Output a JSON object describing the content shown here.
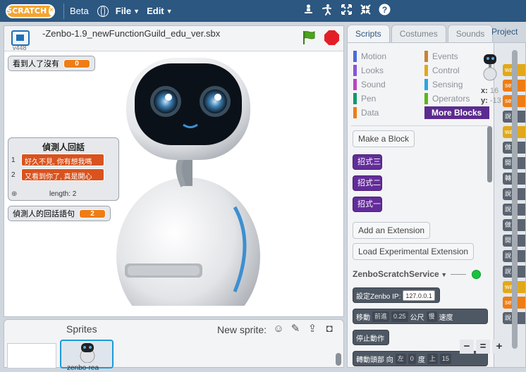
{
  "menubar": {
    "logo": "SCRATCH",
    "beta": "Beta",
    "menus": [
      "File",
      "Edit"
    ],
    "tool_icons": [
      "duplicate-icon",
      "cut-icon",
      "grow-icon",
      "shrink-icon",
      "help-icon"
    ]
  },
  "stage": {
    "version": "v448",
    "project_title": "-Zenbo-1.9_newFunctionGuild_edu_ver.sbx",
    "var1": {
      "label": "看到人了沒有",
      "value": "0"
    },
    "list": {
      "title": "偵測人回話",
      "items": [
        "好久不見, 你有想我嗎",
        "又看到你了, 真是開心"
      ],
      "length": "length: 2"
    },
    "var2": {
      "label": "偵測人的回話語句",
      "value": "2"
    },
    "coords": {
      "x_label": "x:",
      "x": "240",
      "y_label": "y:",
      "y": "-94"
    }
  },
  "sprites": {
    "title": "Sprites",
    "new_sprite": "New sprite:",
    "sprite_name": "zenbo-rea"
  },
  "tabs": {
    "scripts": "Scripts",
    "costumes": "Costumes",
    "sounds": "Sounds",
    "project": "Project"
  },
  "categories": {
    "left": [
      {
        "name": "Motion",
        "color": "#4a6cd4"
      },
      {
        "name": "Looks",
        "color": "#8a55d7"
      },
      {
        "name": "Sound",
        "color": "#bb42c3"
      },
      {
        "name": "Pen",
        "color": "#0e9a6c"
      },
      {
        "name": "Data",
        "color": "#ee7d16"
      }
    ],
    "right": [
      {
        "name": "Events",
        "color": "#c88330"
      },
      {
        "name": "Control",
        "color": "#e1a91a"
      },
      {
        "name": "Sensing",
        "color": "#2ca5e2"
      },
      {
        "name": "Operators",
        "color": "#5cb712"
      },
      {
        "name": "More Blocks",
        "color": "#632d99"
      }
    ]
  },
  "palette": {
    "make_block": "Make a Block",
    "custom_blocks": [
      "招式三",
      "招式二",
      "招式一"
    ],
    "add_extension": "Add an Extension",
    "load_experimental": "Load Experimental Extension",
    "extension_name": "ZenboScratchService",
    "blocks": {
      "set_ip": {
        "label": "設定Zenbo IP:",
        "ip": "127.0.0.1"
      },
      "move": {
        "label": "移動",
        "dir": "前進",
        "dist": "0.25",
        "unit": "公尺",
        "speed": "慢",
        "speed_label": "速度"
      },
      "stop": {
        "label": "停止動作"
      },
      "head": {
        "label": "轉動頭部 向",
        "dir": "左",
        "deg": "0",
        "unit": "度",
        "dir2": "上",
        "deg2": "15"
      }
    }
  },
  "script_area": {
    "sprite_x": "16",
    "sprite_y": "-13",
    "edge_blocks": [
      {
        "text": "wa",
        "color": "#e1a91a"
      },
      {
        "text": "set",
        "color": "#ee7d16"
      },
      {
        "text": "set",
        "color": "#ee7d16"
      },
      {
        "text": "說",
        "color": "#5a6370"
      },
      {
        "text": "wa",
        "color": "#e1a91a"
      },
      {
        "text": "做",
        "color": "#5a6370"
      },
      {
        "text": "開",
        "color": "#5a6370"
      },
      {
        "text": "轉",
        "color": "#5a6370"
      },
      {
        "text": "說",
        "color": "#5a6370"
      },
      {
        "text": "說",
        "color": "#5a6370"
      },
      {
        "text": "做",
        "color": "#5a6370"
      },
      {
        "text": "開",
        "color": "#5a6370"
      },
      {
        "text": "說",
        "color": "#5a6370"
      },
      {
        "text": "說",
        "color": "#5a6370"
      },
      {
        "text": "wa",
        "color": "#e1a91a"
      },
      {
        "text": "set",
        "color": "#ee7d16"
      },
      {
        "text": "說",
        "color": "#5a6370"
      }
    ]
  }
}
